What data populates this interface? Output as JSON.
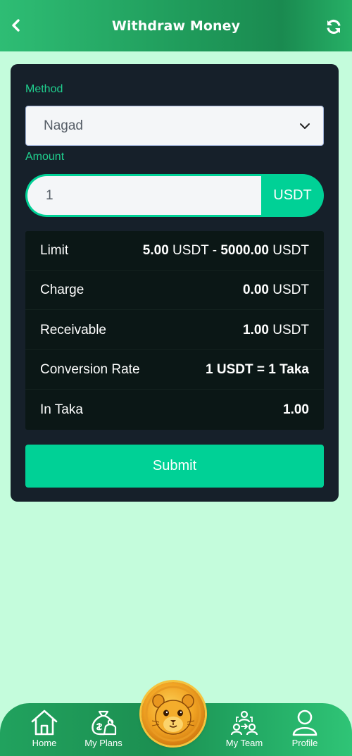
{
  "header": {
    "title": "Withdraw Money",
    "back_icon": "chevron-left-icon",
    "refresh_icon": "refresh-icon"
  },
  "form": {
    "method_label": "Method",
    "method_value": "Nagad",
    "amount_label": "Amount",
    "amount_value": "1",
    "amount_unit": "USDT",
    "submit_label": "Submit"
  },
  "info": {
    "limit": {
      "label": "Limit",
      "min": "5.00",
      "min_unit": " USDT - ",
      "max": "5000.00",
      "max_unit": " USDT"
    },
    "charge": {
      "label": "Charge",
      "value": "0.00",
      "unit": " USDT"
    },
    "receivable": {
      "label": "Receivable",
      "value": "1.00",
      "unit": " USDT"
    },
    "conversion": {
      "label": "Conversion Rate",
      "value": "1 USDT = 1 Taka"
    },
    "taka": {
      "label": "In Taka",
      "value": "1.00"
    }
  },
  "nav": {
    "items": [
      {
        "label": "Home",
        "icon": "home-icon"
      },
      {
        "label": "My Plans",
        "icon": "money-bag-icon"
      },
      {
        "label": "",
        "icon": "hamster-coin-icon"
      },
      {
        "label": "My Team",
        "icon": "team-icon"
      },
      {
        "label": "Profile",
        "icon": "user-icon"
      }
    ]
  },
  "colors": {
    "accent": "#00d196",
    "label": "#20cf8e",
    "background": "#c4fcdc",
    "card": "#16202a",
    "header_green": "#1f9a5a"
  }
}
